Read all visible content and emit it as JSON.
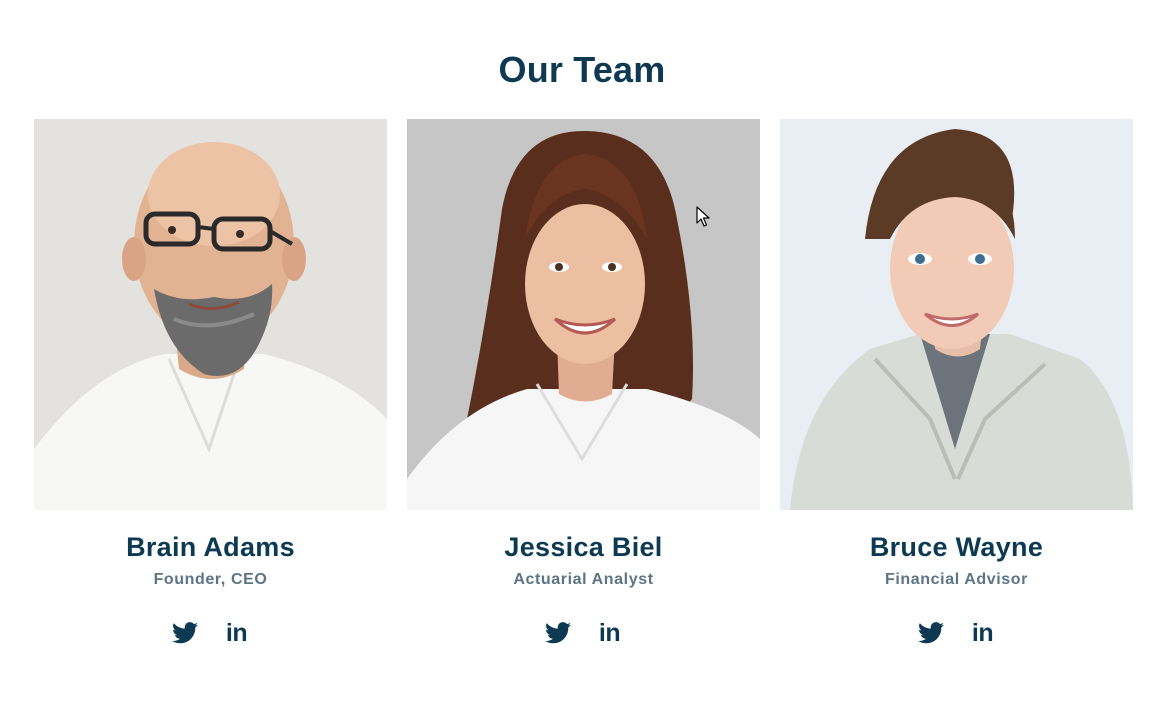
{
  "section": {
    "title": "Our Team"
  },
  "team": [
    {
      "name": "Brain Adams",
      "role": "Founder, CEO",
      "photo_description_icon": "portrait-bald-man-glasses-icon",
      "socials": [
        {
          "icon": "twitter-icon"
        },
        {
          "icon": "linkedin-icon",
          "glyph": "in"
        }
      ]
    },
    {
      "name": "Jessica Biel",
      "role": "Actuarial Analyst",
      "photo_description_icon": "portrait-woman-brown-hair-icon",
      "socials": [
        {
          "icon": "twitter-icon"
        },
        {
          "icon": "linkedin-icon",
          "glyph": "in"
        }
      ]
    },
    {
      "name": "Bruce Wayne",
      "role": "Financial Advisor",
      "photo_description_icon": "portrait-woman-updo-icon",
      "socials": [
        {
          "icon": "twitter-icon"
        },
        {
          "icon": "linkedin-icon",
          "glyph": "in"
        }
      ]
    }
  ],
  "colors": {
    "heading": "#0d3a52",
    "subtitle": "#5d7484",
    "background": "#ffffff"
  }
}
